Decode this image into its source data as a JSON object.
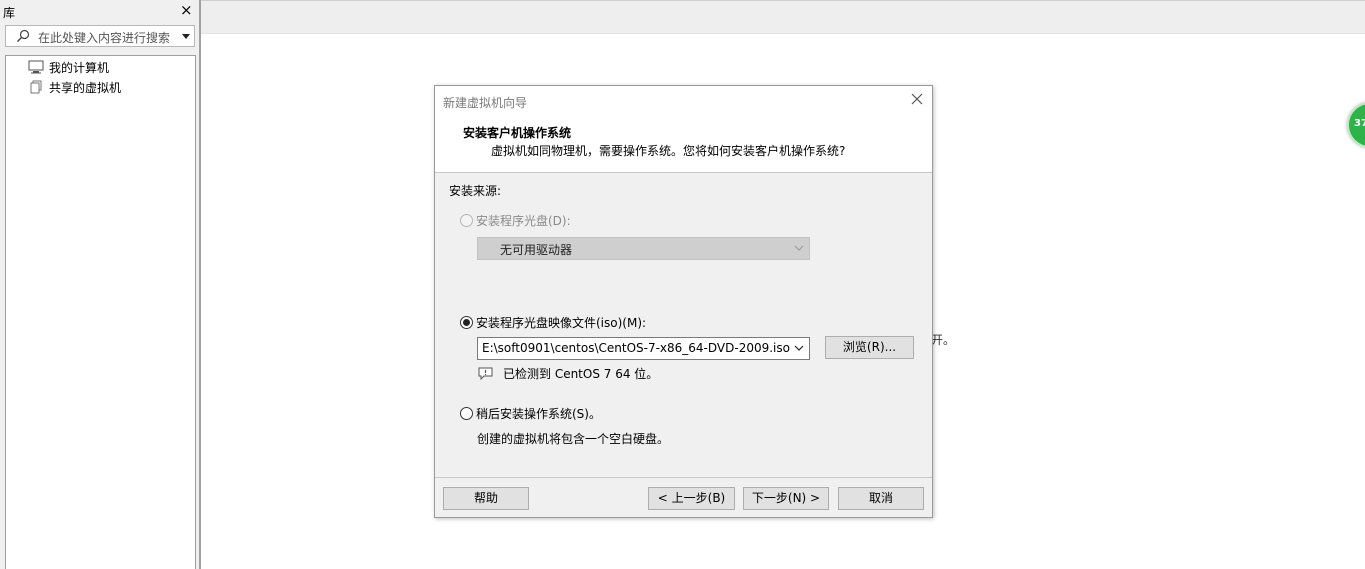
{
  "library": {
    "title": "库",
    "close_glyph": "×",
    "search_placeholder": "在此处键入内容进行搜索",
    "tree": [
      {
        "label": "我的计算机",
        "icon": "computer-icon"
      },
      {
        "label": "共享的虚拟机",
        "icon": "shared-vm-icon"
      }
    ]
  },
  "background": {
    "text_fragment": "开。"
  },
  "badge": {
    "text": "37",
    "color": "#2fb24a"
  },
  "dialog": {
    "title": "新建虚拟机向导",
    "heading": "安装客户机操作系统",
    "subheading": "虚拟机如同物理机，需要操作系统。您将如何安装客户机操作系统?",
    "source_label": "安装来源:",
    "options": {
      "disc": {
        "label": "安装程序光盘(D):",
        "state": "disabled",
        "drive_value": "无可用驱动器"
      },
      "iso": {
        "label": "安装程序光盘映像文件(iso)(M):",
        "state": "selected",
        "path_value": "E:\\soft0901\\centos\\CentOS-7-x86_64-DVD-2009.iso",
        "browse_label": "浏览(R)...",
        "detected_text": "已检测到 CentOS 7 64 位。"
      },
      "later": {
        "label": "稍后安装操作系统(S)。",
        "state": "unselected",
        "description": "创建的虚拟机将包含一个空白硬盘。"
      }
    },
    "buttons": {
      "help": "帮助",
      "back": "< 上一步(B)",
      "next": "下一步(N) >",
      "cancel": "取消"
    }
  }
}
